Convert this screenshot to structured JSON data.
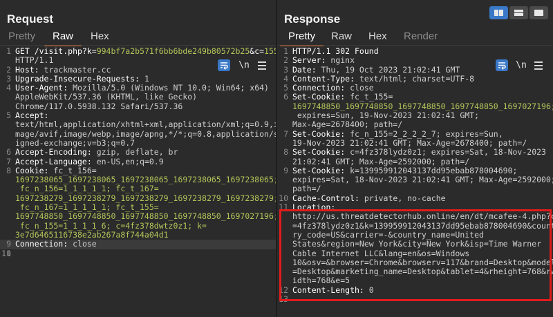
{
  "request": {
    "title": "Request",
    "tabs": [
      {
        "label": "Pretty"
      },
      {
        "label": "Raw"
      },
      {
        "label": "Hex"
      }
    ],
    "nl_label": "\\n",
    "lines": [
      {
        "n": "1",
        "parts": [
          "GET /visit.php?k=",
          "994bf7a2b571f6bb6bde249b80572b25",
          "&c=",
          "155"
        ],
        "cont": [
          "HTTP/1.1"
        ]
      },
      {
        "n": "2",
        "key": "Host:",
        "val": " trackmaster.cc"
      },
      {
        "n": "3",
        "key": "Upgrade-Insecure-Requests:",
        "val": " 1"
      },
      {
        "n": "4",
        "key": "User-Agent:",
        "val": " Mozilla/5.0 (Windows NT 10.0; Win64; x64)",
        "cont": [
          "AppleWebKit/537.36 (KHTML, like Gecko)",
          "Chrome/117.0.5938.132 Safari/537.36"
        ]
      },
      {
        "n": "5",
        "key": "Accept:",
        "val": "",
        "cont": [
          "text/html,application/xhtml+xml,application/xml;q=0.9,i",
          "mage/avif,image/webp,image/apng,*/*;q=0.8,application/s",
          "igned-exchange;v=b3;q=0.7"
        ]
      },
      {
        "n": "6",
        "key": "Accept-Encoding:",
        "val": " gzip, deflate, br"
      },
      {
        "n": "7",
        "key": "Accept-Language:",
        "val": " en-US,en;q=0.9"
      },
      {
        "n": "8",
        "key": "Cookie:",
        "val": " fc_t_156=",
        "contg": [
          "1697238065_1697238065_1697238065_1697238065_1697238065;",
          " fc_n_156=1_1_1_1_1; fc_t_167=",
          "1697238279_1697238279_1697238279_1697238279_1697238279;",
          " fc_n_167=1_1_1_1_1; fc_t_155=",
          "1697748850_1697748850_1697748850_1697748850_1697027196;",
          " fc_n_155=1_1_1_1_6; c=4fz378dwtz0z1; k=",
          "3e7d6465116738e2ab267a8f744a04d1"
        ]
      },
      {
        "n": "9",
        "key": "Connection:",
        "val": " close",
        "hl": true
      },
      {
        "n": "10",
        "key": "",
        "val": ""
      },
      {
        "n": "11",
        "key": "",
        "val": ""
      }
    ]
  },
  "response": {
    "title": "Response",
    "tabs": [
      {
        "label": "Pretty"
      },
      {
        "label": "Raw"
      },
      {
        "label": "Hex"
      },
      {
        "label": "Render"
      }
    ],
    "nl_label": "\\n",
    "lines": [
      {
        "n": "1",
        "key": "HTTP/1.1 302 Found",
        "val": ""
      },
      {
        "n": "2",
        "key": "Server:",
        "val": " nginx"
      },
      {
        "n": "3",
        "key": "Date:",
        "val": " Thu, 19 Oct 2023 21:02:41 GMT"
      },
      {
        "n": "4",
        "key": "Content-Type:",
        "val": " text/html; charset=UTF-8"
      },
      {
        "n": "5",
        "key": "Connection:",
        "val": " close"
      },
      {
        "n": "6",
        "key": "Set-Cookie:",
        "val": " fc_t_155=",
        "contg": [
          "1697748850_1697748850_1697748850_1697748850_1697027196;"
        ],
        "cont": [
          " expires=Sun, 19-Nov-2023 21:02:41 GMT;",
          "Max-Age=2678400; path=/"
        ]
      },
      {
        "n": "7",
        "key": "Set-Cookie:",
        "val": " fc_n_155=2_2_2_2_7; expires=Sun,",
        "cont": [
          "19-Nov-2023 21:02:41 GMT; Max-Age=2678400; path=/"
        ]
      },
      {
        "n": "8",
        "key": "Set-Cookie:",
        "val": " c=4fz378lydz0z1; expires=Sat, 18-Nov-2023",
        "cont": [
          "21:02:41 GMT; Max-Age=2592000; path=/"
        ]
      },
      {
        "n": "9",
        "key": "Set-Cookie:",
        "val": " k=139959912043137dd95ebab878004690;",
        "cont": [
          "expires=Sat, 18-Nov-2023 21:02:41 GMT; Max-Age=2592000;",
          "path=/"
        ]
      },
      {
        "n": "10",
        "key": "Cache-Control:",
        "val": " private, no-cache"
      },
      {
        "n": "11",
        "key": "Location:",
        "val": "",
        "cont": [
          "http://us.threatdetectorhub.online/en/dt/mcafee-4.php?c",
          "=4fz378lydz0z1&k=139959912043137dd95ebab878004690&count",
          "ry_code=US&carrier=-&country_name=United",
          "States&region=New York&city=New York&isp=Time Warner",
          "Cable Internet LLC&lang=en&os=Windows",
          "10&osv=&browser=Chrome&browserv=117&brand=Desktop&model",
          "=Desktop&marketing_name=Desktop&tablet=4&rheight=768&rw",
          "idth=768&e=5"
        ]
      },
      {
        "n": "12",
        "key": "Content-Length:",
        "val": " 0"
      },
      {
        "n": "13",
        "key": "",
        "val": ""
      }
    ]
  },
  "colors": {
    "accent": "#e8743b",
    "highlight_box": "#e21b1b",
    "wrap_button": "#3a78c8",
    "cookie_value": "#b5c45a"
  }
}
